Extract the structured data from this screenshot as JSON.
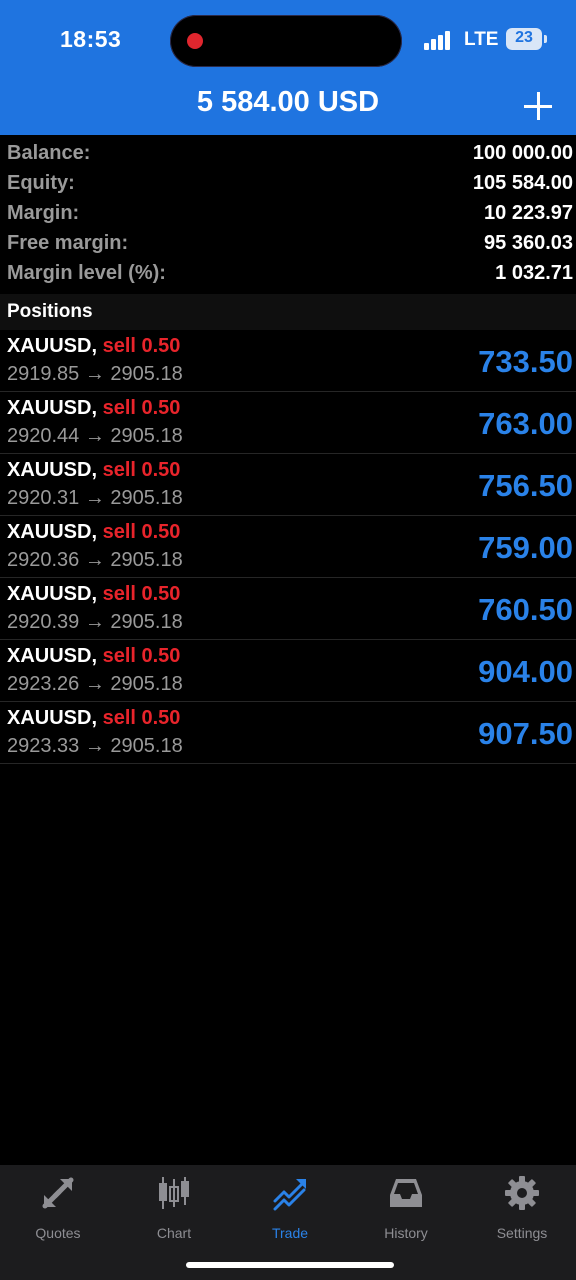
{
  "status_bar": {
    "time": "18:53",
    "network": "LTE",
    "battery": "23"
  },
  "header": {
    "title": "5 584.00 USD",
    "add_icon": "plus-icon"
  },
  "account": [
    {
      "label": "Balance:",
      "value": "100 000.00"
    },
    {
      "label": "Equity:",
      "value": "105 584.00"
    },
    {
      "label": "Margin:",
      "value": "10 223.97"
    },
    {
      "label": "Free margin:",
      "value": "95 360.03"
    },
    {
      "label": "Margin level (%):",
      "value": "1 032.71"
    }
  ],
  "positions_title": "Positions",
  "positions": [
    {
      "symbol": "XAUUSD,",
      "side": "sell 0.50",
      "prices": "2919.85 → 2905.18",
      "profit": "733.50"
    },
    {
      "symbol": "XAUUSD,",
      "side": "sell 0.50",
      "prices": "2920.44 → 2905.18",
      "profit": "763.00"
    },
    {
      "symbol": "XAUUSD,",
      "side": "sell 0.50",
      "prices": "2920.31 → 2905.18",
      "profit": "756.50"
    },
    {
      "symbol": "XAUUSD,",
      "side": "sell 0.50",
      "prices": "2920.36 → 2905.18",
      "profit": "759.00"
    },
    {
      "symbol": "XAUUSD,",
      "side": "sell 0.50",
      "prices": "2920.39 → 2905.18",
      "profit": "760.50"
    },
    {
      "symbol": "XAUUSD,",
      "side": "sell 0.50",
      "prices": "2923.26 → 2905.18",
      "profit": "904.00"
    },
    {
      "symbol": "XAUUSD,",
      "side": "sell 0.50",
      "prices": "2923.33 → 2905.18",
      "profit": "907.50"
    }
  ],
  "tabs": [
    {
      "label": "Quotes",
      "icon": "quotes-icon"
    },
    {
      "label": "Chart",
      "icon": "chart-icon"
    },
    {
      "label": "Trade",
      "icon": "trade-icon",
      "active": true
    },
    {
      "label": "History",
      "icon": "history-icon"
    },
    {
      "label": "Settings",
      "icon": "settings-icon"
    }
  ],
  "colors": {
    "header_bg": "#1f74e0",
    "accent_blue": "#2a82e8",
    "sell_red": "#e8242b",
    "muted_gray": "#9a9a9a"
  }
}
